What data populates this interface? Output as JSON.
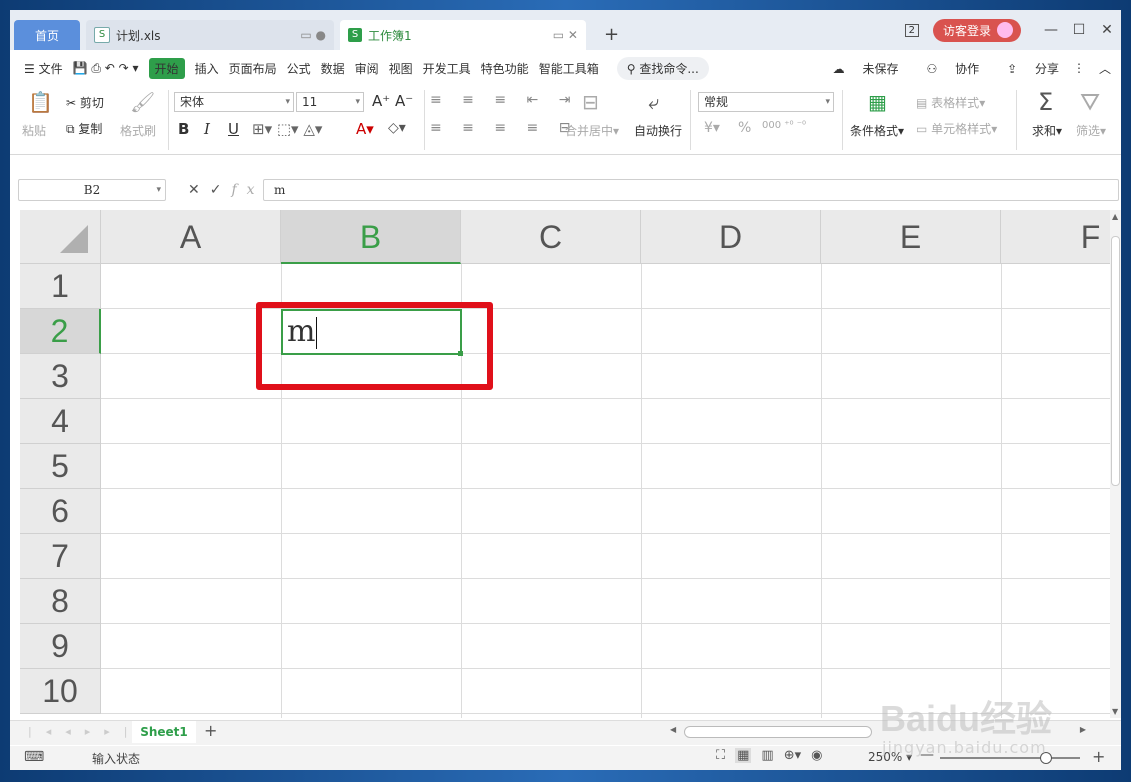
{
  "tabs": {
    "home": "首页",
    "file1": "计划.xls",
    "active": "工作簿1",
    "add": "+"
  },
  "titlebar": {
    "badge": "2",
    "guest_login": "访客登录",
    "minimize": "—",
    "maximize": "☐",
    "close": "✕"
  },
  "menu": {
    "file": "文件",
    "items": [
      "开始",
      "插入",
      "页面布局",
      "公式",
      "数据",
      "审阅",
      "视图",
      "开发工具",
      "特色功能",
      "智能工具箱"
    ],
    "search": "查找命令...",
    "unsaved": "未保存",
    "collab": "协作",
    "share": "分享"
  },
  "ribbon": {
    "paste": "粘贴",
    "cut": "剪切",
    "copy": "复制",
    "format_painter": "格式刷",
    "font_name": "宋体",
    "font_size": "11",
    "bold": "B",
    "italic": "I",
    "underline": "U",
    "merge_center": "合并居中",
    "wrap_text": "自动换行",
    "number_format": "常规",
    "percent": "%",
    "yen": "¥",
    "cond_format": "条件格式",
    "table_style": "表格样式",
    "cell_style": "单元格样式",
    "sum": "求和",
    "filter": "筛选"
  },
  "formula_bar": {
    "name_box": "B2",
    "content": "m",
    "fx": "fx"
  },
  "grid": {
    "columns": [
      "A",
      "B",
      "C",
      "D",
      "E",
      "F"
    ],
    "rows": [
      "1",
      "2",
      "3",
      "4",
      "5",
      "6",
      "7",
      "8",
      "9",
      "10"
    ],
    "selected_column": "B",
    "selected_row": "2",
    "active_cell_value": "m"
  },
  "sheets": {
    "tabs": [
      "Sheet1"
    ],
    "add": "+"
  },
  "status": {
    "mode": "输入状态",
    "zoom": "250%"
  },
  "watermark": {
    "line1": "Baidu经验",
    "line2": "jingyan.baidu.com"
  },
  "colors": {
    "accent_green": "#2e9e4a",
    "highlight_red": "#e0101a",
    "home_tab_blue": "#5b8fdc"
  }
}
